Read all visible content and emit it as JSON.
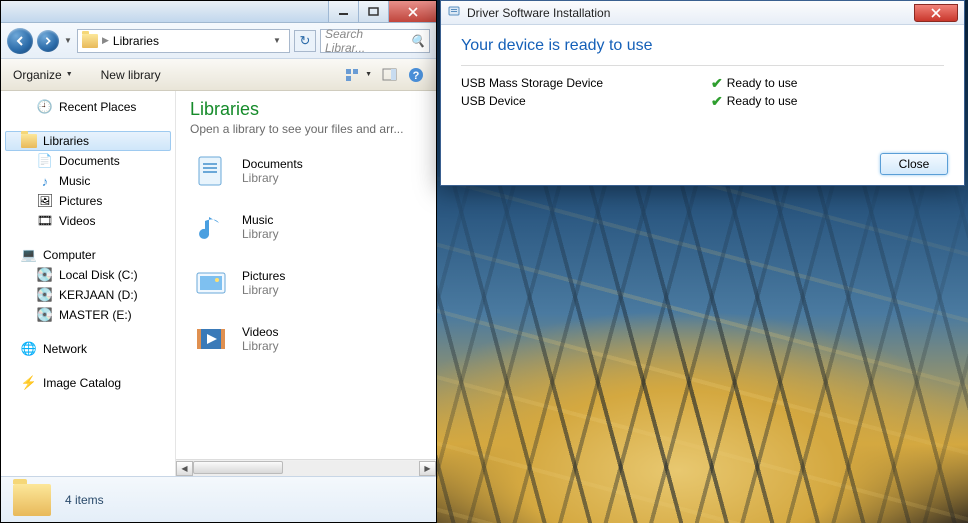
{
  "explorer": {
    "address": "Libraries",
    "search_placeholder": "Search Librar...",
    "toolbar": {
      "organize": "Organize",
      "new_library": "New library"
    },
    "sidebar": {
      "recent": "Recent Places",
      "libraries": "Libraries",
      "lib_items": [
        "Documents",
        "Music",
        "Pictures",
        "Videos"
      ],
      "computer": "Computer",
      "drives": [
        "Local Disk (C:)",
        "KERJAAN (D:)",
        "MASTER (E:)"
      ],
      "network": "Network",
      "image_catalog": "Image Catalog"
    },
    "content": {
      "title": "Libraries",
      "subtitle": "Open a library to see your files and arr...",
      "items": [
        {
          "name": "Documents",
          "kind": "Library"
        },
        {
          "name": "Music",
          "kind": "Library"
        },
        {
          "name": "Pictures",
          "kind": "Library"
        },
        {
          "name": "Videos",
          "kind": "Library"
        }
      ]
    },
    "status": "4 items"
  },
  "dialog": {
    "title": "Driver Software Installation",
    "heading": "Your device is ready to use",
    "devices": [
      {
        "name": "USB Mass Storage Device",
        "status": "Ready to use"
      },
      {
        "name": "USB Device",
        "status": "Ready to use"
      }
    ],
    "close": "Close"
  }
}
